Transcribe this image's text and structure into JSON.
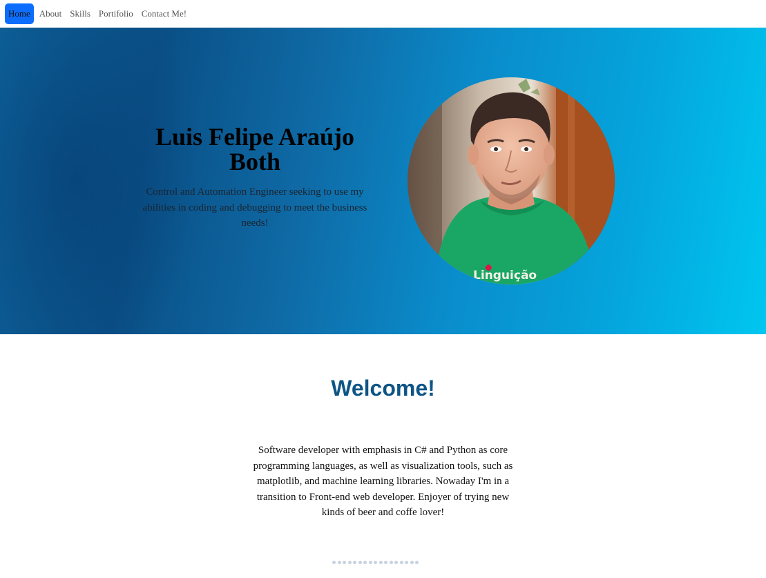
{
  "nav": {
    "items": [
      "Home",
      "About",
      "Skills",
      "Portifolio",
      "Contact Me!"
    ],
    "active_index": 0,
    "active_color": "#0d6efd"
  },
  "hero": {
    "name": "Luis Felipe Araújo Both",
    "tagline": "Control and Automation Engineer seeking to use my abilities in coding and debugging to meet the business needs!",
    "photo": {
      "description_icon": "profile-photo",
      "shirt_text": "Linguição"
    },
    "gradient_colors": [
      "#0a4f86",
      "#05a4dc",
      "#00c6f0"
    ]
  },
  "welcome": {
    "title": "Welcome!",
    "text": "Software developer with emphasis in C# and Python as core programming languages, as well as visualization tools, such as matplotlib, and machine learning libraries. Nowaday I'm in a transition to Front-end web developer. Enjoyer of trying new kinds of beer and coffe lover!",
    "title_color": "#0e5585"
  },
  "pagination_dots": {
    "count": 17
  }
}
